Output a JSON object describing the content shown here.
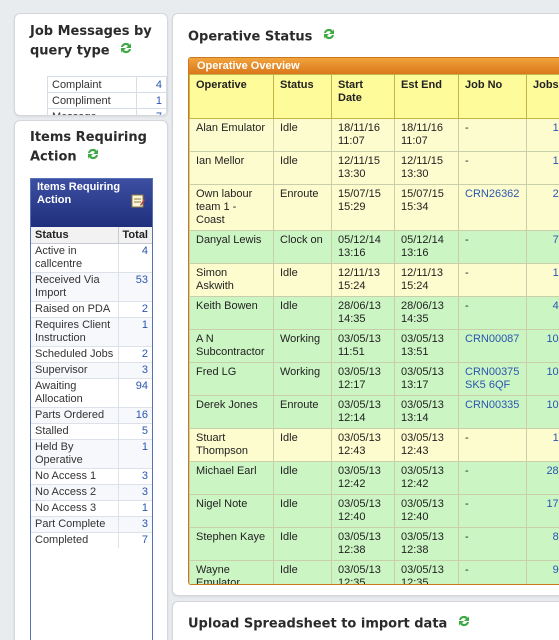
{
  "job_messages": {
    "title": "Job Messages by query type",
    "rows": [
      {
        "label": "Complaint",
        "count": "4"
      },
      {
        "label": "Compliment",
        "count": "1"
      },
      {
        "label": "Message",
        "count": "7"
      }
    ]
  },
  "items_action": {
    "title": "Items Requiring Action",
    "box_title": "Items Requiring Action",
    "col_status": "Status",
    "col_total": "Total",
    "rows": [
      {
        "label": "Active in callcentre",
        "count": "4"
      },
      {
        "label": "Received Via Import",
        "count": "53"
      },
      {
        "label": "Raised on PDA",
        "count": "2"
      },
      {
        "label": "Requires Client Instruction",
        "count": "1"
      },
      {
        "label": "Scheduled Jobs",
        "count": "2"
      },
      {
        "label": "Supervisor",
        "count": "3"
      },
      {
        "label": "Awaiting Allocation",
        "count": "94"
      },
      {
        "label": "Parts Ordered",
        "count": "16"
      },
      {
        "label": "Stalled",
        "count": "5"
      },
      {
        "label": "Held By Operative",
        "count": "1"
      },
      {
        "label": "No Access 1",
        "count": "3"
      },
      {
        "label": "No Access 2",
        "count": "3"
      },
      {
        "label": "No Access 3",
        "count": "1"
      },
      {
        "label": "Part Complete",
        "count": "3"
      },
      {
        "label": "Completed",
        "count": "7"
      }
    ]
  },
  "operative_status": {
    "title": "Operative Status",
    "overview_title": "Operative Overview",
    "columns": [
      "Operative",
      "Status",
      "Start Date",
      "Est End",
      "Job No",
      "Jobs"
    ],
    "rows": [
      {
        "operative": "Alan Emulator",
        "status": "Idle",
        "start": "18/11/16 11:07",
        "end": "18/11/16 11:07",
        "job": "-",
        "jobs": "1",
        "shade": "idle-y"
      },
      {
        "operative": "Ian Mellor",
        "status": "Idle",
        "start": "12/11/15 13:30",
        "end": "12/11/15 13:30",
        "job": "-",
        "jobs": "1",
        "shade": "idle-y"
      },
      {
        "operative": "Own labour team 1 - Coast",
        "status": "Enroute",
        "start": "15/07/15 15:29",
        "end": "15/07/15 15:34",
        "job": "CRN26362",
        "jobs": "2",
        "shade": "idle-y"
      },
      {
        "operative": "Danyal Lewis",
        "status": "Clock on",
        "start": "05/12/14 13:16",
        "end": "05/12/14 13:16",
        "job": "-",
        "jobs": "7",
        "shade": "green"
      },
      {
        "operative": "Simon Askwith",
        "status": "Idle",
        "start": "12/11/13 15:24",
        "end": "12/11/13 15:24",
        "job": "-",
        "jobs": "1",
        "shade": "idle-y"
      },
      {
        "operative": "Keith Bowen",
        "status": "Idle",
        "start": "28/06/13 14:35",
        "end": "28/06/13 14:35",
        "job": "-",
        "jobs": "4",
        "shade": "green"
      },
      {
        "operative": "A N Subcontractor",
        "status": "Working",
        "start": "03/05/13 11:51",
        "end": "03/05/13 13:51",
        "job": "CRN00087",
        "jobs": "10",
        "shade": "green"
      },
      {
        "operative": "Fred LG",
        "status": "Working",
        "start": "03/05/13 12:17",
        "end": "03/05/13 13:17",
        "job": "CRN00375 SK5 6QF",
        "jobs": "10",
        "shade": "green"
      },
      {
        "operative": "Derek Jones",
        "status": "Enroute",
        "start": "03/05/13 12:14",
        "end": "03/05/13 13:14",
        "job": "CRN00335",
        "jobs": "10",
        "shade": "green"
      },
      {
        "operative": "Stuart Thompson",
        "status": "Idle",
        "start": "03/05/13 12:43",
        "end": "03/05/13 12:43",
        "job": "-",
        "jobs": "1",
        "shade": "idle-y"
      },
      {
        "operative": "Michael Earl",
        "status": "Idle",
        "start": "03/05/13 12:42",
        "end": "03/05/13 12:42",
        "job": "-",
        "jobs": "28",
        "shade": "green"
      },
      {
        "operative": "Nigel Note",
        "status": "Idle",
        "start": "03/05/13 12:40",
        "end": "03/05/13 12:40",
        "job": "-",
        "jobs": "17",
        "shade": "green"
      },
      {
        "operative": "Stephen Kaye",
        "status": "Idle",
        "start": "03/05/13 12:38",
        "end": "03/05/13 12:38",
        "job": "-",
        "jobs": "8",
        "shade": "green"
      },
      {
        "operative": "Wayne Emulator",
        "status": "Idle",
        "start": "03/05/13 12:35",
        "end": "03/05/13 12:35",
        "job": "-",
        "jobs": "9",
        "shade": "green"
      },
      {
        "operative": "Karl Casio",
        "status": "Idle",
        "start": "03/05/13 11:32",
        "end": "03/05/13 12:32",
        "job": "-",
        "jobs": "11",
        "shade": "green"
      }
    ]
  },
  "upload": {
    "title": "Upload Spreadsheet to import data"
  },
  "icons": {
    "refresh": "refresh-icon",
    "notes": "notes-icon"
  },
  "colors": {
    "refresh_green": "#3ea844",
    "overview_orange": "#e58a22",
    "items_blue": "#2a3a8c",
    "link_blue": "#2a56b0",
    "row_yellow": "#fdfcce",
    "row_green": "#ccf5c4"
  }
}
